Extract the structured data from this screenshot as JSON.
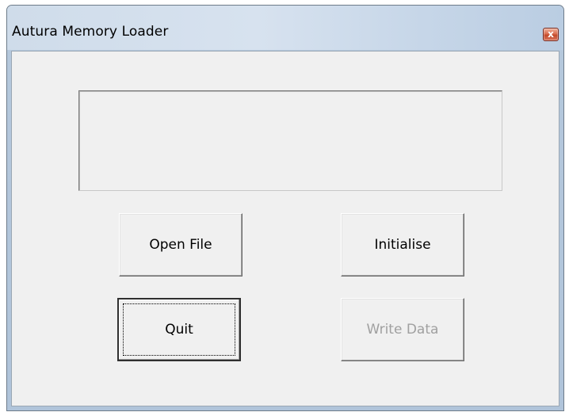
{
  "window": {
    "title": "Autura Memory Loader",
    "close_label": "x"
  },
  "display": {
    "text": ""
  },
  "buttons": {
    "open_file": "Open File",
    "initialise": "Initialise",
    "quit": "Quit",
    "write_data": "Write Data"
  },
  "state": {
    "default_button": "quit",
    "disabled_buttons": [
      "write_data"
    ]
  },
  "colors": {
    "titlebar": "#c6d6e8",
    "client_background": "#f0f0f0",
    "close_button": "#c44a2c",
    "disabled_text": "#a0a0a0"
  }
}
